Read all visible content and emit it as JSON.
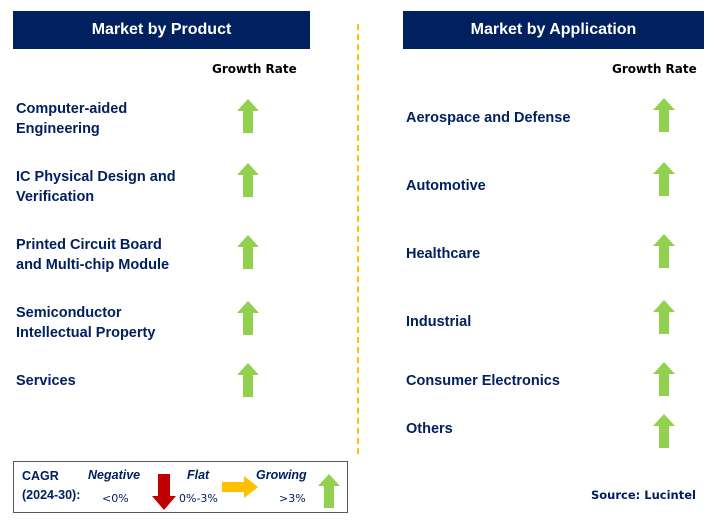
{
  "left_panel": {
    "title": "Market by Product",
    "growth_label": "Growth Rate",
    "items": [
      {
        "label_line1": "Computer-aided",
        "label_line2": "Engineering",
        "trend": "growing"
      },
      {
        "label_line1": "IC Physical Design and",
        "label_line2": "Verification",
        "trend": "growing"
      },
      {
        "label_line1": "Printed Circuit Board",
        "label_line2": "and Multi-chip Module",
        "trend": "growing"
      },
      {
        "label_line1": "Semiconductor",
        "label_line2": "Intellectual Property",
        "trend": "growing"
      },
      {
        "label_line1": "Services",
        "label_line2": "",
        "trend": "growing"
      }
    ]
  },
  "right_panel": {
    "title": "Market by Application",
    "growth_label": "Growth Rate",
    "items": [
      {
        "label": "Aerospace and Defense",
        "trend": "growing"
      },
      {
        "label": "Automotive",
        "trend": "growing"
      },
      {
        "label": "Healthcare",
        "trend": "growing"
      },
      {
        "label": "Industrial",
        "trend": "growing"
      },
      {
        "label": "Consumer Electronics",
        "trend": "growing"
      },
      {
        "label": "Others",
        "trend": "growing"
      }
    ]
  },
  "legend": {
    "cagr_line1": "CAGR",
    "cagr_line2": "(2024-30):",
    "negative_label": "Negative",
    "negative_range": "<0%",
    "flat_label": "Flat",
    "flat_range": "0%-3%",
    "growing_label": "Growing",
    "growing_range": ">3%"
  },
  "source": "Source: Lucintel",
  "colors": {
    "header_bg": "#002060",
    "text": "#002060",
    "growing": "#92d050",
    "flat": "#ffc000",
    "negative": "#c00000",
    "divider": "#ffc000"
  }
}
